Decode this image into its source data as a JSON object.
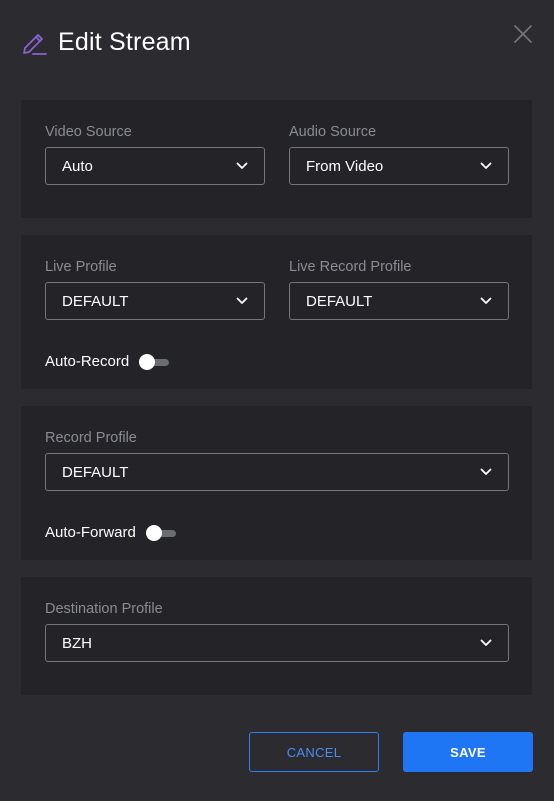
{
  "dialog": {
    "title": "Edit Stream",
    "icons": {
      "edit": "pencil-edit-icon",
      "close": "close-icon",
      "dropdown": "chevron-down-icon"
    }
  },
  "sources": {
    "video_source": {
      "label": "Video Source",
      "value": "Auto"
    },
    "audio_source": {
      "label": "Audio Source",
      "value": "From Video"
    }
  },
  "live": {
    "live_profile": {
      "label": "Live Profile",
      "value": "DEFAULT"
    },
    "live_record_profile": {
      "label": "Live Record Profile",
      "value": "DEFAULT"
    },
    "auto_record": {
      "label": "Auto-Record",
      "enabled": false
    }
  },
  "record": {
    "record_profile": {
      "label": "Record Profile",
      "value": "DEFAULT"
    },
    "auto_forward": {
      "label": "Auto-Forward",
      "enabled": false
    }
  },
  "destination": {
    "destination_profile": {
      "label": "Destination Profile",
      "value": "BZH"
    }
  },
  "actions": {
    "cancel_label": "CANCEL",
    "save_label": "SAVE"
  },
  "colors": {
    "background": "#2b2b30",
    "card": "#232328",
    "accent": "#1f76f5",
    "icon_accent": "#8a63d2",
    "label": "#8b8b93"
  }
}
